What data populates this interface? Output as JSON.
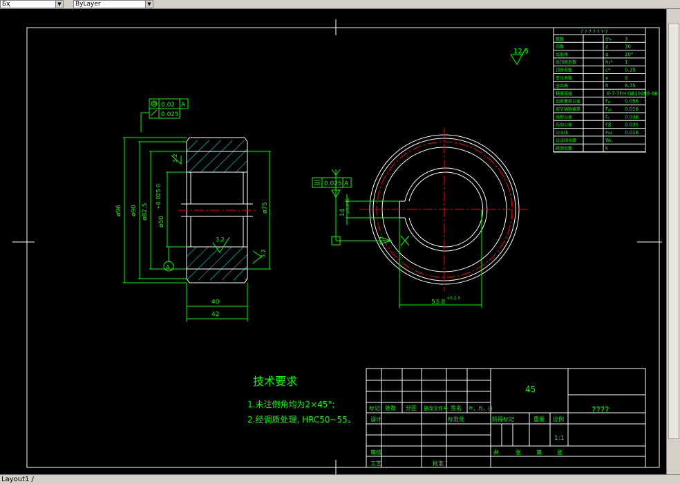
{
  "toolbar": {
    "layer_combo": "Бҳ",
    "linetype_combo": "ByLayer"
  },
  "statusbar": {
    "layout_tab": "Layout1 /"
  },
  "drawing": {
    "surface_finish_general": "12.5",
    "roughness_values": [
      "3.2",
      "3.2",
      "3.2"
    ],
    "gdt_top": {
      "concentric": "0.02",
      "datum": "A",
      "runout": "0.025"
    },
    "gdt_mid": {
      "symmetry": "0.025",
      "datum": "A"
    },
    "datum_label": "A",
    "dims": {
      "od": "ø96",
      "d90": "ø90",
      "d825": "ø82.5",
      "bore": "ø50",
      "bore_tol": "+0.025\n0",
      "d75": "ø75",
      "w40": "40",
      "w42": "42",
      "key": "14",
      "key_tol": "±0.043",
      "d538": "53.8",
      "d538_tol": "+0.2\n0"
    },
    "tech_title": "技术要求",
    "tech_notes": [
      "1.未注倒角均为2×45°;",
      "2.经调质处理, HRC50~55。"
    ],
    "material": "45",
    "part_name": "????",
    "scale": "1:1",
    "title_cells": [
      "标记",
      "处数",
      "分区",
      "更改文件号",
      "签名",
      "年、月、日",
      "设计",
      "标准化",
      "阶段标记",
      "重量",
      "比例",
      "审核",
      "工艺",
      "批准",
      "共",
      "张",
      "第",
      "张"
    ],
    "param_table_title": "? ? ? ? ? ? ?",
    "param_rows": [
      [
        "模数",
        "mₙ",
        "3"
      ],
      [
        "齿数",
        "z",
        "30"
      ],
      [
        "齿形角",
        "α",
        "20°"
      ],
      [
        "齿顶高系数",
        "hₐ*",
        "1"
      ],
      [
        "顶隙系数",
        "c*",
        "0.25"
      ],
      [
        "变位系数",
        "x",
        "0"
      ],
      [
        "全齿高",
        "h",
        "6.75"
      ],
      [
        "精度等级",
        "",
        "8-7-7FH GB10095-88"
      ],
      [
        "齿距累积公差",
        "Fₚ",
        "0.056"
      ],
      [
        "周节极限偏差",
        "Fₚₖ",
        "0.016"
      ],
      [
        "齿形公差",
        "fₓ",
        "0.038"
      ],
      [
        "齿向公差",
        "Fβ",
        "0.035"
      ],
      [
        "公法线",
        "Fω",
        "0.016"
      ],
      [
        "公法线长度",
        "Wₖ",
        ""
      ],
      [
        "跨测齿数",
        "k",
        ""
      ]
    ],
    "colors": {
      "frame": "#ffffff",
      "geometry": "#ffffff",
      "dims": "#00ff00",
      "center": "#ff0000",
      "hatch": "#00ffff",
      "text_green": "#00ff00"
    }
  }
}
